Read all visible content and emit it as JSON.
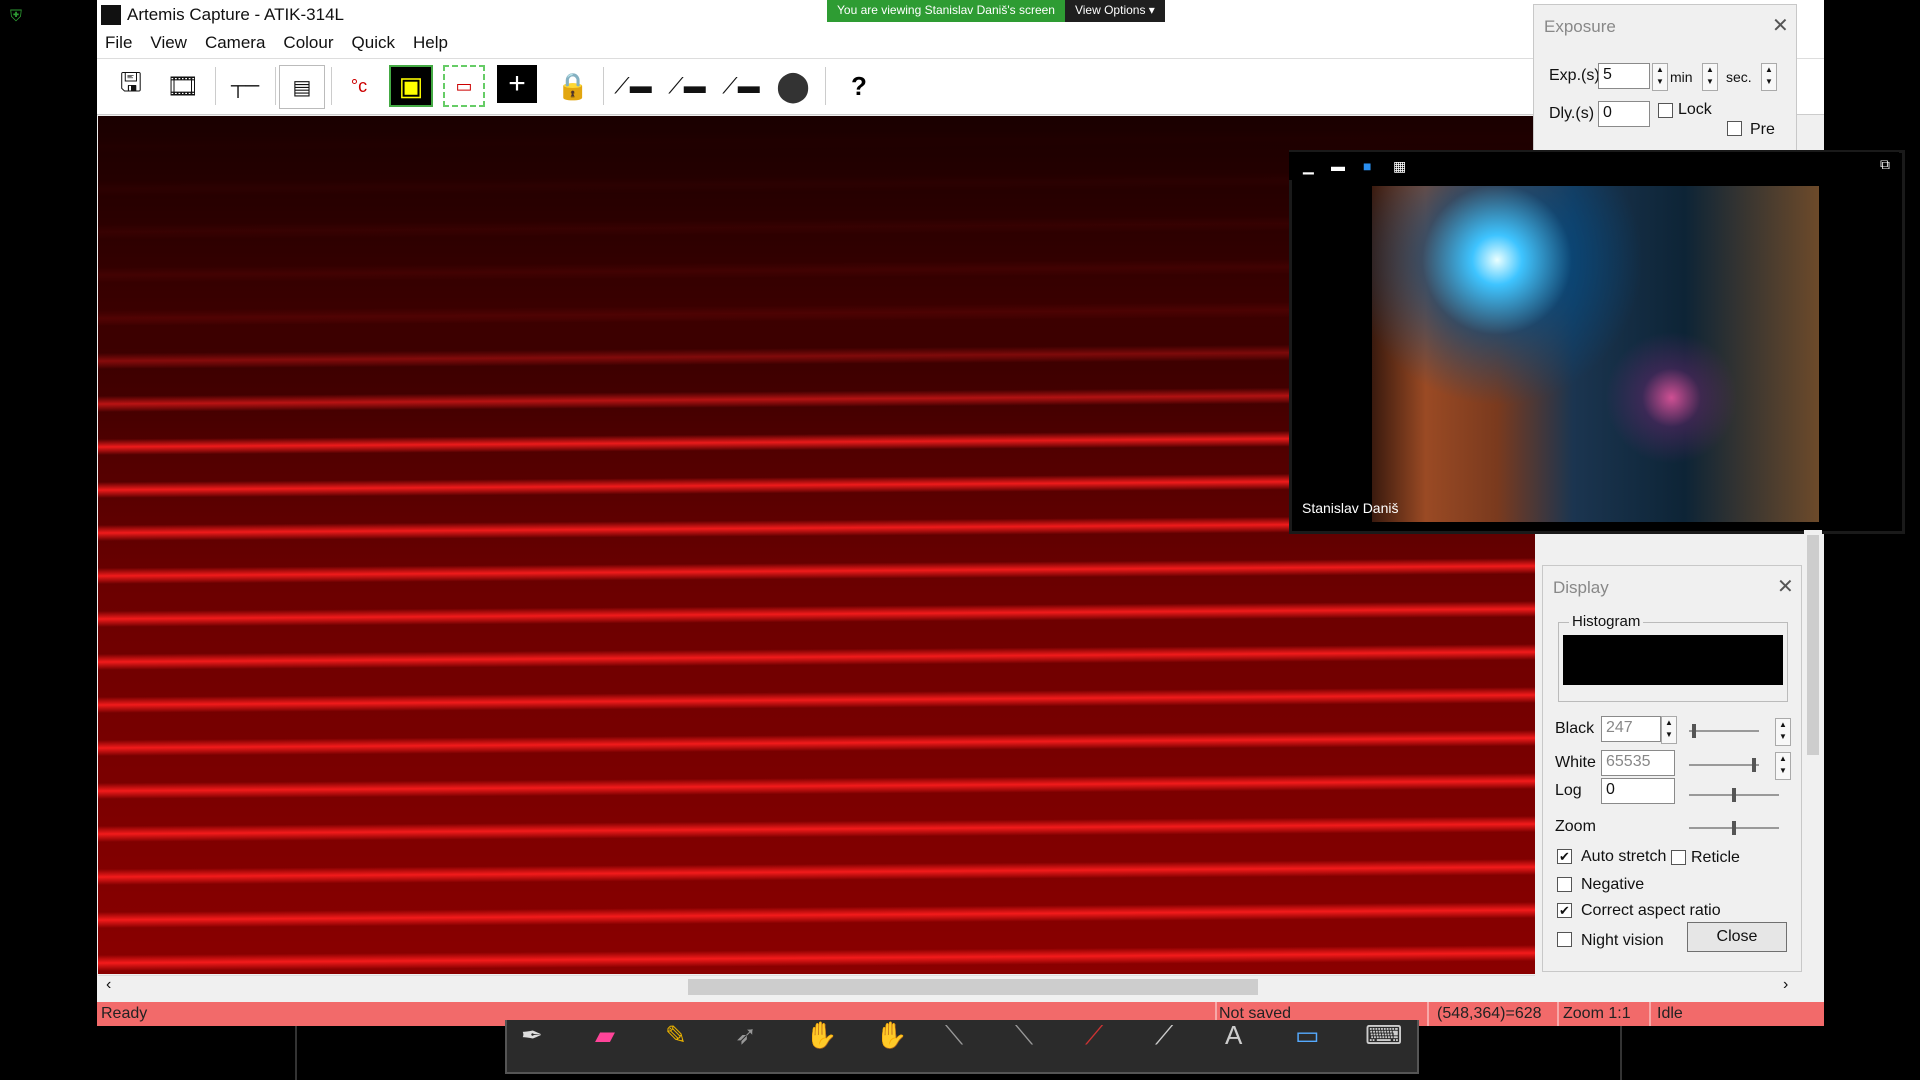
{
  "window": {
    "title": "Artemis Capture - ATIK-314L"
  },
  "menu": [
    "File",
    "View",
    "Camera",
    "Colour",
    "Quick",
    "Help"
  ],
  "toolbar": {
    "icons": [
      "save-icon",
      "save-sequence-icon",
      "crosshair-line-icon",
      "settings-panel-icon",
      "temperature-icon",
      "focus-frame-icon",
      "subframe-icon",
      "add-reticle-icon",
      "lock-icon",
      "single-exposure-icon",
      "continuous-exposure-icon",
      "numbered-exposure-icon",
      "colour-wheel-icon",
      "help-icon"
    ],
    "temp_symbol": "°c"
  },
  "share_banner": {
    "message": "You are viewing Stanislav Daniš's screen",
    "options_label": "View Options"
  },
  "exposure": {
    "title": "Exposure",
    "exp_label": "Exp.(s)",
    "exp_value": "5",
    "min_label": "min",
    "sec_label": "sec.",
    "dly_label": "Dly.(s)",
    "dly_value": "0",
    "lock_label": "Lock",
    "pre_label": "Pre"
  },
  "video": {
    "participant_name": "Stanislav Daniš"
  },
  "display": {
    "title": "Display",
    "histogram_label": "Histogram",
    "black_label": "Black",
    "black_value": "247",
    "black_level": 0.05,
    "white_label": "White",
    "white_value": "65535",
    "white_level": 0.95,
    "log_label": "Log",
    "log_value": "0",
    "log_level": 0.5,
    "zoom_label": "Zoom",
    "zoom_level": 0.5,
    "auto_stretch_label": "Auto stretch",
    "auto_stretch_checked": true,
    "reticle_label": "Reticle",
    "reticle_checked": false,
    "negative_label": "Negative",
    "negative_checked": false,
    "aspect_label": "Correct aspect ratio",
    "aspect_checked": true,
    "night_label": "Night vision",
    "night_checked": false,
    "close_label": "Close"
  },
  "status": {
    "state": "Ready",
    "save_state": "Not saved",
    "pixel": "(548,364)=628",
    "zoom": "Zoom 1:1",
    "camera": "Idle"
  },
  "colors": {
    "status_bar": "#f26a6a",
    "share_green": "#2e9c33"
  }
}
